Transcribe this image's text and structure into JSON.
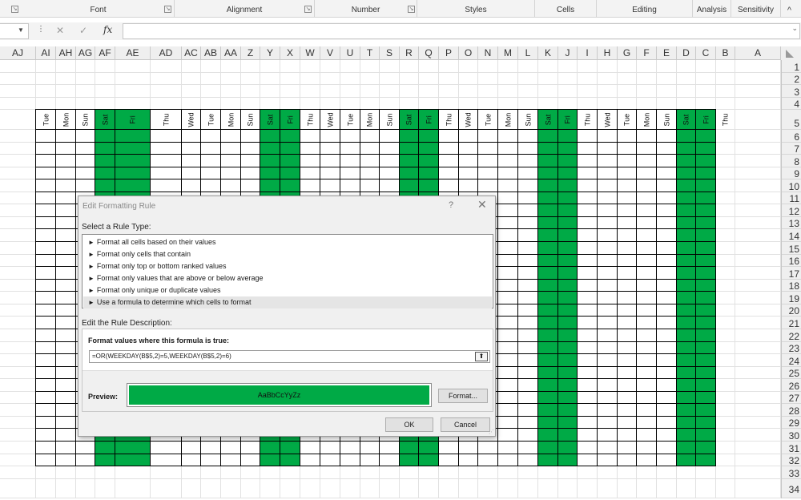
{
  "ribbon": {
    "groups": [
      {
        "label": "Font"
      },
      {
        "label": "Alignment"
      },
      {
        "label": "Number"
      },
      {
        "label": "Styles"
      },
      {
        "label": "Cells"
      },
      {
        "label": "Editing"
      },
      {
        "label": "Analysis"
      },
      {
        "label": "Sensitivity"
      }
    ],
    "collapse_glyph": "^"
  },
  "formula_bar": {
    "cancel_glyph": "✕",
    "enter_glyph": "✓",
    "fx_label": "fx",
    "value": ""
  },
  "columns": [
    "AJ",
    "AI",
    "AH",
    "AG",
    "AF",
    "AE",
    "AD",
    "AC",
    "AB",
    "AA",
    "Z",
    "Y",
    "X",
    "W",
    "V",
    "U",
    "T",
    "S",
    "R",
    "Q",
    "P",
    "O",
    "N",
    "M",
    "L",
    "K",
    "J",
    "I",
    "H",
    "G",
    "F",
    "E",
    "D",
    "C",
    "B",
    "A"
  ],
  "rows": [
    "1",
    "2",
    "3",
    "4",
    "5",
    "6",
    "7",
    "8",
    "9",
    "10",
    "11",
    "12",
    "13",
    "14",
    "15",
    "16",
    "17",
    "18",
    "19",
    "20",
    "21",
    "22",
    "23",
    "24",
    "25",
    "26",
    "27",
    "28",
    "29",
    "30",
    "31",
    "32",
    "33",
    "34"
  ],
  "day_headers": [
    "Tue",
    "Mon",
    "Sun",
    "Sat",
    "Fri",
    "Thu",
    "Wed",
    "Tue",
    "Mon",
    "Sun",
    "Sat",
    "Fri",
    "Thu",
    "Wed",
    "Tue",
    "Mon",
    "Sun",
    "Sat",
    "Fri",
    "Thu",
    "Wed",
    "Tue",
    "Mon",
    "Sun",
    "Sat",
    "Fri",
    "Thu",
    "Wed",
    "Tue",
    "Mon",
    "Sun",
    "Sat",
    "Fri",
    "Thu"
  ],
  "weekend_fill_color": "#00aa46",
  "dialog": {
    "title": "Edit Formatting Rule",
    "help_glyph": "?",
    "close_glyph": "✕",
    "select_rule_label": "Select a Rule Type:",
    "rule_types": [
      {
        "label": "Format all cells based on their values"
      },
      {
        "label": "Format only cells that contain"
      },
      {
        "label": "Format only top or bottom ranked values"
      },
      {
        "label": "Format only values that are above or below average"
      },
      {
        "label": "Format only unique or duplicate values"
      },
      {
        "label": "Use a formula to determine which cells to format"
      }
    ],
    "selected_rule_index": 5,
    "edit_description_label": "Edit the Rule Description:",
    "formula_label": "Format values where this formula is true:",
    "formula_value": "=OR(WEEKDAY(B$5,2)=5,WEEKDAY(B$5,2)=6)",
    "preview_label": "Preview:",
    "preview_text": "AaBbCcYyZz",
    "preview_color": "#00aa46",
    "format_button": "Format...",
    "ok_button": "OK",
    "cancel_button": "Cancel"
  }
}
